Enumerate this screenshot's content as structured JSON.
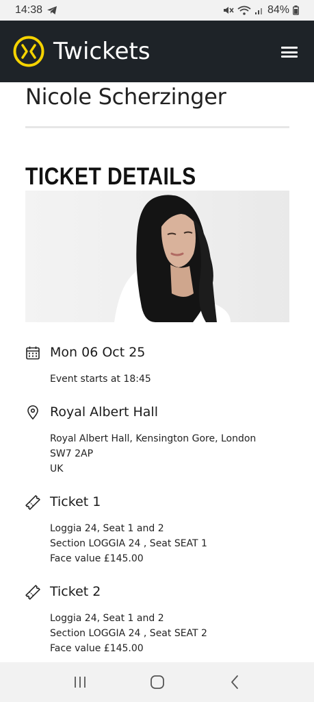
{
  "status_bar": {
    "time": "14:38",
    "battery": "84%"
  },
  "header": {
    "brand": "Twickets"
  },
  "event": {
    "title": "Nicole Scherzinger"
  },
  "section": {
    "heading": "TICKET DETAILS"
  },
  "date": {
    "title": "Mon 06 Oct 25",
    "lines": [
      "Event starts at 18:45"
    ]
  },
  "venue": {
    "title": "Royal Albert Hall",
    "lines": [
      "Royal Albert Hall, Kensington Gore, London",
      "SW7 2AP",
      "UK"
    ]
  },
  "tickets": [
    {
      "title": "Ticket 1",
      "lines": [
        "Loggia 24, Seat 1 and 2",
        "Section LOGGIA 24 , Seat SEAT 1",
        "Face value £145.00"
      ]
    },
    {
      "title": "Ticket 2",
      "lines": [
        "Loggia 24, Seat 1 and 2",
        "Section LOGGIA 24 , Seat SEAT 2",
        "Face value £145.00"
      ]
    }
  ],
  "colors": {
    "header_bg": "#1e2328",
    "logo_accent": "#f5d300"
  }
}
